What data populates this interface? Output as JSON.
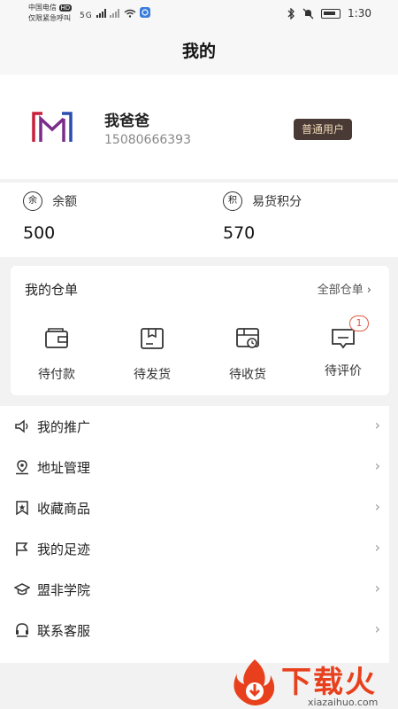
{
  "status_bar": {
    "carrier_line1": "中国电信",
    "carrier_badge": "HD",
    "carrier_line2": "仅限紧急呼叫",
    "network_left": "5G",
    "time": "1:30"
  },
  "header": {
    "title": "我的"
  },
  "profile": {
    "name": "我爸爸",
    "phone": "15080666393",
    "badge": "普通用户"
  },
  "balance": {
    "left": {
      "icon_char": "余",
      "label": "余额",
      "value": "500"
    },
    "right": {
      "icon_char": "积",
      "label": "易货积分",
      "value": "570"
    }
  },
  "orders": {
    "title": "我的仓单",
    "all_label": "全部仓单",
    "items": [
      {
        "label": "待付款",
        "icon": "wallet-icon"
      },
      {
        "label": "待发货",
        "icon": "box-icon"
      },
      {
        "label": "待收货",
        "icon": "truck-icon"
      },
      {
        "label": "待评价",
        "icon": "comment-icon",
        "badge": "1"
      }
    ]
  },
  "menu": {
    "items": [
      {
        "label": "我的推广",
        "icon": "speaker-icon"
      },
      {
        "label": "地址管理",
        "icon": "location-icon"
      },
      {
        "label": "收藏商品",
        "icon": "bookmark-icon"
      },
      {
        "label": "我的足迹",
        "icon": "flag-icon"
      },
      {
        "label": "盟非学院",
        "icon": "graduation-cap-icon"
      },
      {
        "label": "联系客服",
        "icon": "headset-icon"
      }
    ],
    "chevron": "›"
  },
  "watermark": {
    "text": "下载火",
    "sub": "xiazaihuo.com"
  },
  "colors": {
    "badge_bg": "#4a3a36",
    "badge_text": "#f0d9b5",
    "notif": "#e05a44",
    "watermark": "#e8401c"
  }
}
